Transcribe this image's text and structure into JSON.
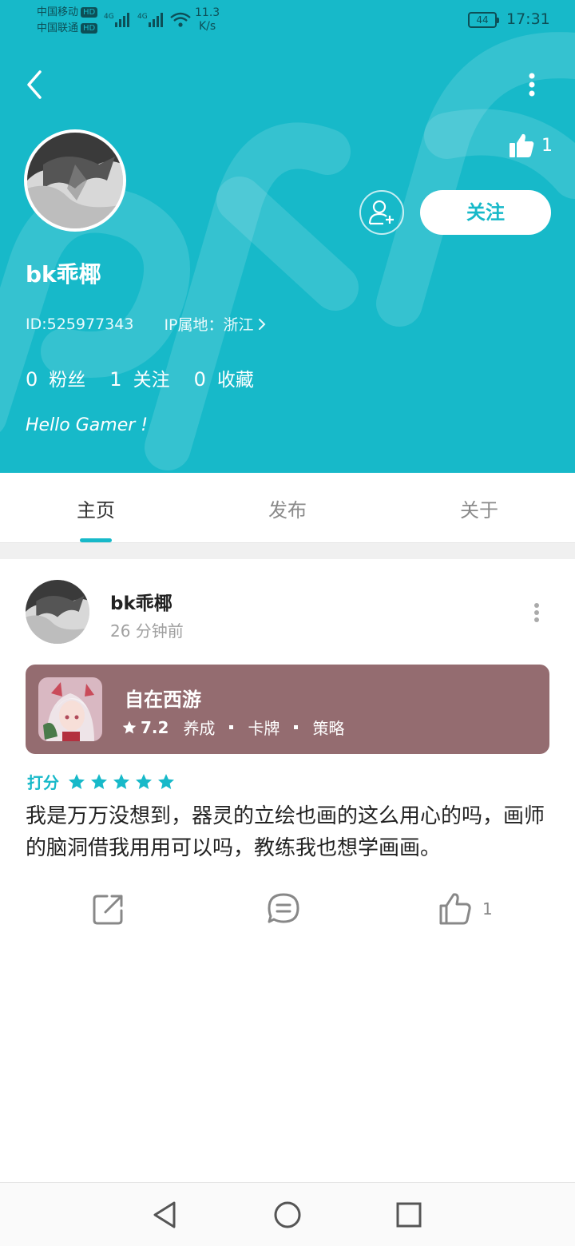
{
  "status_bar": {
    "carrier1": "中国移动",
    "carrier2": "中国联通",
    "hd": "HD",
    "net_type": "4G",
    "net_speed_value": "11.3",
    "net_speed_unit": "K/s",
    "battery": "44",
    "time": "17:31"
  },
  "profile": {
    "like_count": "1",
    "follow_label": "关注",
    "username": "bk乖椰",
    "id": "ID:525977343",
    "ip_location": "IP属地：浙江",
    "stats": [
      {
        "value": "0",
        "label": "粉丝"
      },
      {
        "value": "1",
        "label": "关注"
      },
      {
        "value": "0",
        "label": "收藏"
      }
    ],
    "bio": "Hello Gamer !"
  },
  "tabs": [
    {
      "label": "主页"
    },
    {
      "label": "发布"
    },
    {
      "label": "关于"
    }
  ],
  "post": {
    "author": "bk乖椰",
    "time": "26 分钟前",
    "game": {
      "name": "自在西游",
      "rating": "7.2",
      "tags": [
        "养成",
        "卡牌",
        "策略"
      ]
    },
    "rating_label": "打分",
    "stars": 5,
    "content": "我是万万没想到，器灵的立绘也画的这么用心的吗，画师的脑洞借我用用可以吗，教练我也想学画画。",
    "like_count": "1"
  },
  "colors": {
    "accent": "#17b9c9",
    "game_card": "#946c70"
  },
  "icons": {
    "back": "back-arrow-icon",
    "more": "more-vertical-icon",
    "like": "thumbs-up-icon",
    "add_friend": "add-user-icon",
    "share": "share-icon",
    "comment": "comment-icon",
    "star": "star-icon"
  }
}
